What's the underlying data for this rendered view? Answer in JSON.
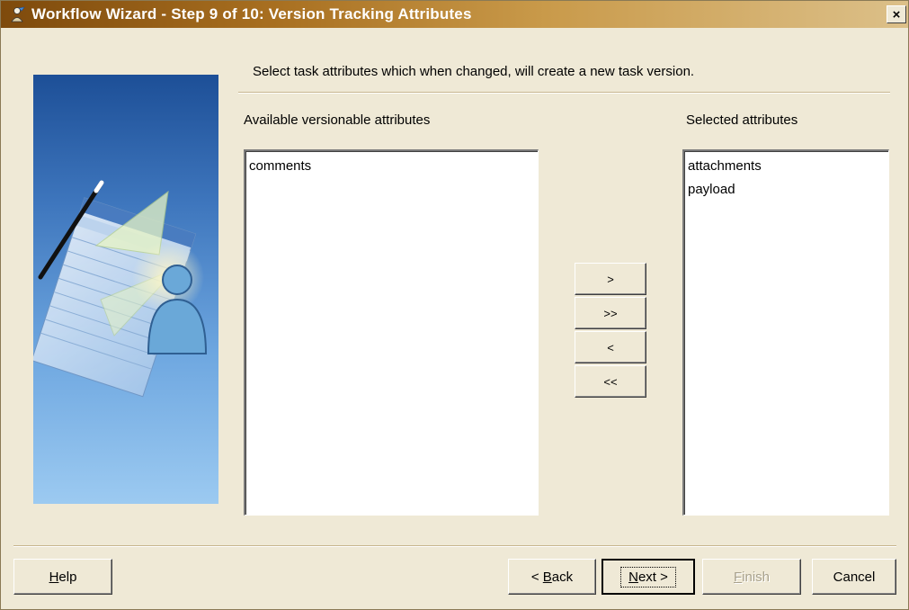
{
  "window": {
    "title": "Workflow Wizard - Step 9 of 10: Version Tracking Attributes",
    "close_label": "×"
  },
  "instruction": "Select task attributes which when changed, will create a new task version.",
  "available": {
    "label": "Available versionable attributes",
    "items": [
      "comments"
    ]
  },
  "selected": {
    "label": "Selected attributes",
    "items": [
      "attachments",
      "payload"
    ]
  },
  "move_buttons": {
    "add": ">",
    "add_all": ">>",
    "remove": "<",
    "remove_all": "<<"
  },
  "footer": {
    "help": {
      "mnemonic": "H",
      "rest": "elp"
    },
    "back": {
      "prefix": "< ",
      "mnemonic": "B",
      "rest": "ack"
    },
    "next": {
      "mnemonic": "N",
      "rest": "ext >"
    },
    "finish": {
      "mnemonic": "F",
      "rest": "inish",
      "enabled": false
    },
    "cancel": "Cancel"
  },
  "colors": {
    "dialog_bg": "#efe9d6",
    "titlebar_start": "#7e4a0c",
    "titlebar_end": "#dcc089"
  }
}
